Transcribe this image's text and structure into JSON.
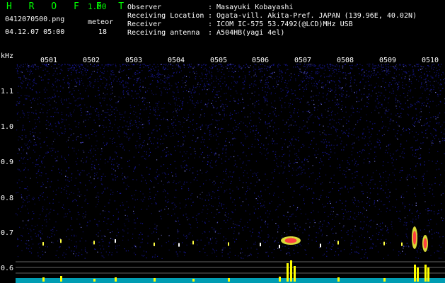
{
  "header": {
    "app_title": "H R O F F T",
    "app_version": "1.00",
    "file_name": "0412070500.png",
    "datetime": "04.12.07 05:00",
    "meteor_label": "meteor",
    "meteor_count": "18",
    "info": [
      {
        "label": "Observer",
        "value": ": Masayuki Kobayashi"
      },
      {
        "label": "Receiving Location",
        "value": ": Ogata-vill. Akita-Pref. JAPAN (139.96E, 40.02N)"
      },
      {
        "label": "Receiver",
        "value": ": ICOM IC-575 53.7492(@LCD)MHz USB"
      },
      {
        "label": "Receiving antenna",
        "value": ": A504HB(yagi 4el)"
      }
    ]
  },
  "axis": {
    "y_unit": "kHz",
    "y_ticks": [
      "1.1",
      "1.0",
      "0.9",
      "0.8",
      "0.7",
      "0.6"
    ],
    "x_ticks": [
      "0501",
      "0502",
      "0503",
      "0504",
      "0505",
      "0506",
      "0507",
      "0508",
      "0509",
      "0510"
    ]
  },
  "colors": {
    "background": "#000000",
    "noise": "#1a1aa8",
    "text": "#ffffff",
    "title": "#00ff00",
    "meteor_core": "#ff4040",
    "meteor_halo": "#ffff40",
    "histogram": "#ffff00",
    "histogram_base": "#00e0ff"
  }
}
